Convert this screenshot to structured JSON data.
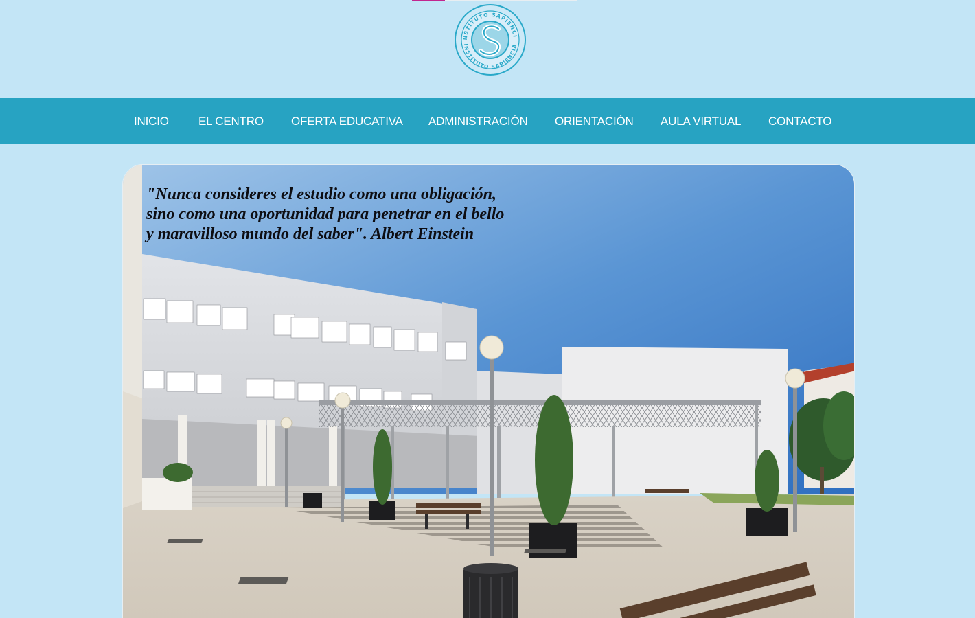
{
  "header": {
    "logo": {
      "text_top": "INSTITUTO SAPIENCIA",
      "text_bottom": "INSTITUTO SAPIENCIA",
      "letter": "S",
      "color": "#2aa9c9"
    },
    "accent_color": "#c2268f"
  },
  "nav": {
    "background": "#27a3c2",
    "items": [
      {
        "label": "INICIO"
      },
      {
        "label": "EL CENTRO"
      },
      {
        "label": "OFERTA EDUCATIVA"
      },
      {
        "label": "ADMINISTRACIÓN"
      },
      {
        "label": "ORIENTACIÓN"
      },
      {
        "label": "AULA VIRTUAL"
      },
      {
        "label": "CONTACTO"
      }
    ]
  },
  "hero": {
    "quote": "\"Nunca consideres el estudio como una obligación,\nsino como una oportunidad para penetrar en el bello\ny maravilloso mundo del saber\". Albert Einstein",
    "image": "school-courtyard-photo"
  }
}
